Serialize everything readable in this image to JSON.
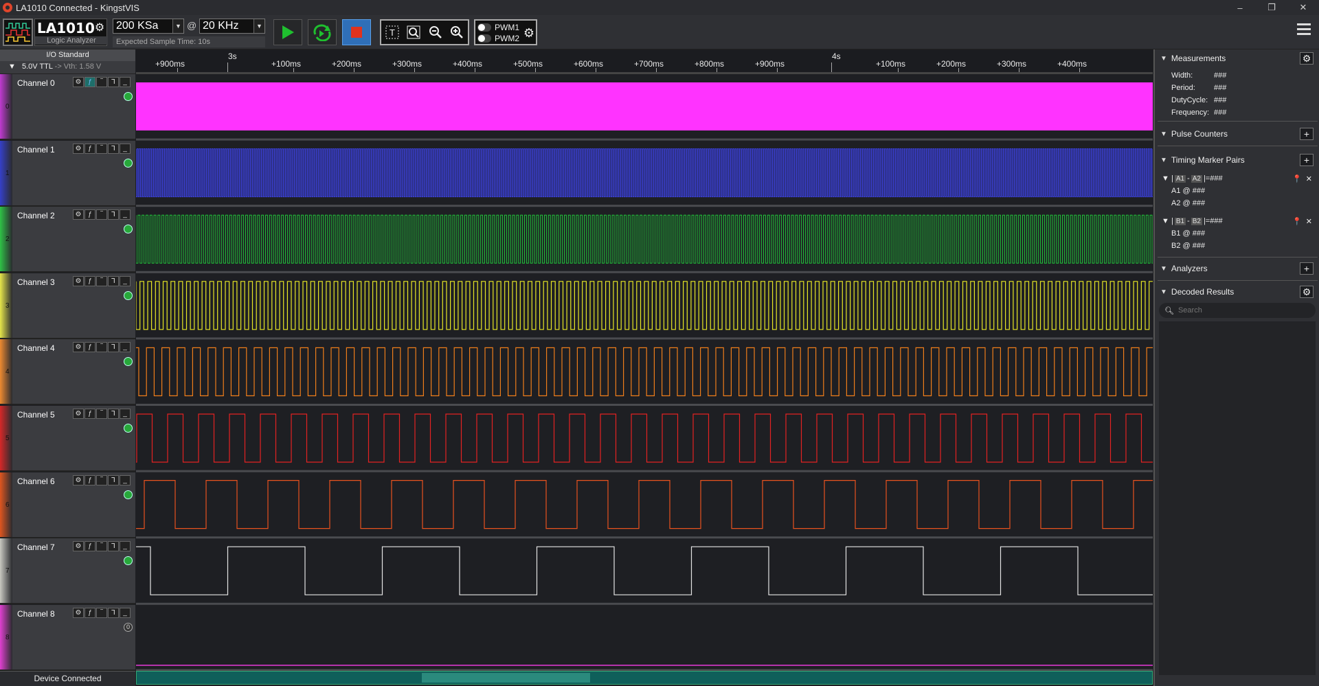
{
  "window": {
    "title": "LA1010 Connected - KingstVIS",
    "controls": [
      "–",
      "❐",
      "✕"
    ]
  },
  "toolbar": {
    "model": "LA1010",
    "model_subtitle": "Logic Analyzer",
    "sample_depth": "200 KSa",
    "at": "@",
    "sample_rate": "20 KHz",
    "expected_time": "Expected Sample Time: 10s",
    "pwm1": "PWM1",
    "pwm2": "PWM2",
    "start_color": "#1fbf2f",
    "stop_color": "#e0321e"
  },
  "io_standard": {
    "title": "I/O Standard",
    "value": "5.0V TTL",
    "vth": "-> Vth: 1.58 V"
  },
  "ruler": {
    "labels": [
      "+900ms",
      "3s",
      "+100ms",
      "+200ms",
      "+300ms",
      "+400ms",
      "+500ms",
      "+600ms",
      "+700ms",
      "+800ms",
      "+900ms",
      "4s",
      "+100ms",
      "+200ms",
      "+300ms",
      "+400ms"
    ]
  },
  "channels": [
    {
      "name": "Channel 0",
      "num": "0",
      "color": "#ff33ff",
      "bar": "#c03ad0",
      "indicator": "on"
    },
    {
      "name": "Channel 1",
      "num": "1",
      "color": "#3d43e8",
      "bar": "#3540c8",
      "indicator": "on"
    },
    {
      "name": "Channel 2",
      "num": "2",
      "color": "#21c43a",
      "bar": "#2fc246",
      "indicator": "on"
    },
    {
      "name": "Channel 3",
      "num": "3",
      "color": "#e8e825",
      "bar": "#e6e64a",
      "indicator": "on"
    },
    {
      "name": "Channel 4",
      "num": "4",
      "color": "#f07e1a",
      "bar": "#ee8a30",
      "indicator": "on"
    },
    {
      "name": "Channel 5",
      "num": "5",
      "color": "#e52222",
      "bar": "#d62828",
      "indicator": "on"
    },
    {
      "name": "Channel 6",
      "num": "6",
      "color": "#e8521e",
      "bar": "#e0561f",
      "indicator": "on"
    },
    {
      "name": "Channel 7",
      "num": "7",
      "color": "#e6e6e6",
      "bar": "#c8c8c0",
      "indicator": "on"
    },
    {
      "name": "Channel 8",
      "num": "8",
      "color": "#e83ad8",
      "bar": "#e040d0",
      "indicator": "0"
    }
  ],
  "status": {
    "device": "Device Connected"
  },
  "right_panel": {
    "measurements": {
      "title": "Measurements",
      "items": [
        {
          "label": "Width:",
          "value": "###"
        },
        {
          "label": "Period:",
          "value": "###"
        },
        {
          "label": "DutyCycle:",
          "value": "###"
        },
        {
          "label": "Frequency:",
          "value": "###"
        }
      ]
    },
    "pulse_counters": {
      "title": "Pulse Counters"
    },
    "timing_marker_pairs": {
      "title": "Timing Marker Pairs",
      "pairs": [
        {
          "a": "A1",
          "b": "A2",
          "value": "###",
          "sub1": "A1 @ ###",
          "sub2": "A2 @ ###"
        },
        {
          "a": "B1",
          "b": "B2",
          "value": "###",
          "sub1": "B1 @ ###",
          "sub2": "B2 @ ###"
        }
      ]
    },
    "analyzers": {
      "title": "Analyzers"
    },
    "decoded_results": {
      "title": "Decoded Results",
      "search_placeholder": "Search"
    }
  }
}
